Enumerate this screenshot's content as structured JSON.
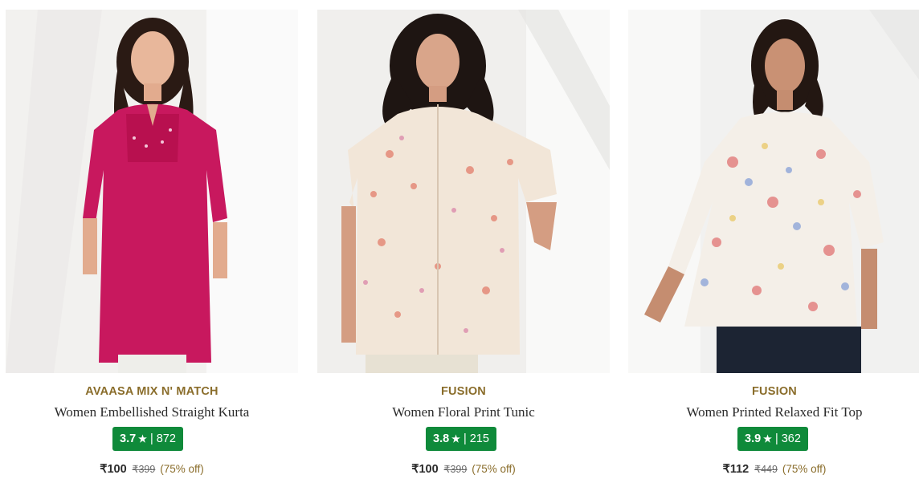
{
  "products": [
    {
      "brand": "AVAASA MIX N' MATCH",
      "title": "Women Embellished Straight Kurta",
      "rating": "3.7",
      "rating_count": "872",
      "price": "₹100",
      "mrp": "₹399",
      "discount": "(75% off)",
      "image_icon": "pink-kurta-photo",
      "garment_color": "#c8185e"
    },
    {
      "brand": "FUSION",
      "title": "Women Floral Print Tunic",
      "rating": "3.8",
      "rating_count": "215",
      "price": "₹100",
      "mrp": "₹399",
      "discount": "(75% off)",
      "image_icon": "floral-tunic-photo",
      "garment_color": "#f2e6d8"
    },
    {
      "brand": "FUSION",
      "title": "Women Printed Relaxed Fit Top",
      "rating": "3.9",
      "rating_count": "362",
      "price": "₹112",
      "mrp": "₹449",
      "discount": "(75% off)",
      "image_icon": "floral-top-photo",
      "garment_color": "#f4efe8"
    }
  ],
  "colors": {
    "brand_text": "#8a6d2b",
    "rating_badge": "#0f8a3a",
    "background": "#ffffff"
  },
  "rating_separator": "|",
  "star_icon": "star-icon"
}
